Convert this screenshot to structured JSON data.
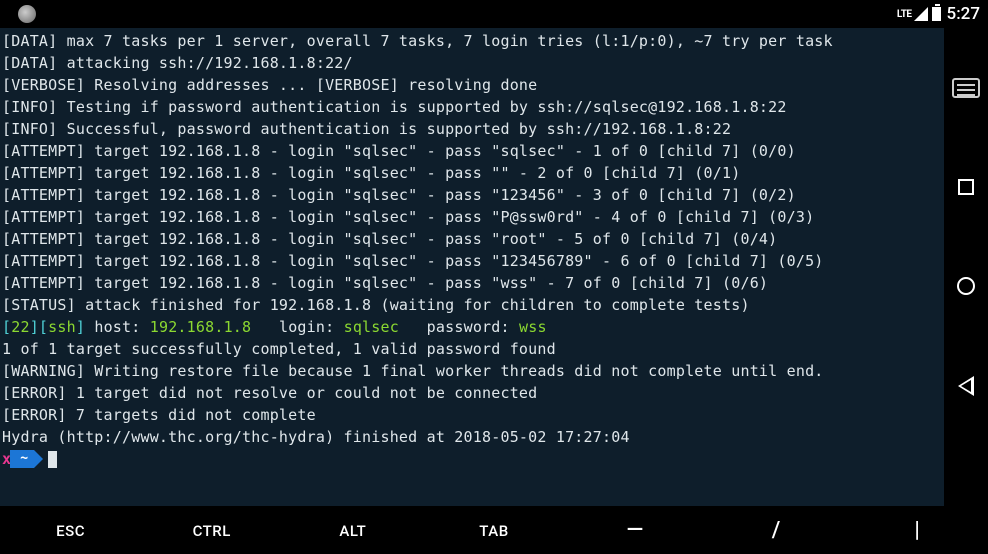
{
  "status": {
    "network": "LTE",
    "clock": "5:27"
  },
  "terminal": {
    "lines": [
      {
        "parts": [
          {
            "c": "lbl",
            "t": "[DATA] max 7 tasks per 1 server, overall 7 tasks, 7 login tries (l:1/p:0), ~7 try per task"
          }
        ]
      },
      {
        "parts": [
          {
            "c": "lbl",
            "t": "[DATA] attacking ssh://192.168.1.8:22/"
          }
        ]
      },
      {
        "parts": [
          {
            "c": "lbl",
            "t": "[VERBOSE] Resolving addresses ... [VERBOSE] resolving done"
          }
        ]
      },
      {
        "parts": [
          {
            "c": "lbl",
            "t": "[INFO] Testing if password authentication is supported by ssh://sqlsec@192.168.1.8:22"
          }
        ]
      },
      {
        "parts": [
          {
            "c": "lbl",
            "t": "[INFO] Successful, password authentication is supported by ssh://192.168.1.8:22"
          }
        ]
      },
      {
        "parts": [
          {
            "c": "lbl",
            "t": "[ATTEMPT] target 192.168.1.8 - login \"sqlsec\" - pass \"sqlsec\" - 1 of 0 [child 7] (0/0)"
          }
        ]
      },
      {
        "parts": [
          {
            "c": "lbl",
            "t": "[ATTEMPT] target 192.168.1.8 - login \"sqlsec\" - pass \"\" - 2 of 0 [child 7] (0/1)"
          }
        ]
      },
      {
        "parts": [
          {
            "c": "lbl",
            "t": "[ATTEMPT] target 192.168.1.8 - login \"sqlsec\" - pass \"123456\" - 3 of 0 [child 7] (0/2)"
          }
        ]
      },
      {
        "parts": [
          {
            "c": "lbl",
            "t": "[ATTEMPT] target 192.168.1.8 - login \"sqlsec\" - pass \"P@ssw0rd\" - 4 of 0 [child 7] (0/3)"
          }
        ]
      },
      {
        "parts": [
          {
            "c": "lbl",
            "t": "[ATTEMPT] target 192.168.1.8 - login \"sqlsec\" - pass \"root\" - 5 of 0 [child 7] (0/4)"
          }
        ]
      },
      {
        "parts": [
          {
            "c": "lbl",
            "t": "[ATTEMPT] target 192.168.1.8 - login \"sqlsec\" - pass \"123456789\" - 6 of 0 [child 7] (0/5)"
          }
        ]
      },
      {
        "parts": [
          {
            "c": "lbl",
            "t": "[ATTEMPT] target 192.168.1.8 - login \"sqlsec\" - pass \"wss\" - 7 of 0 [child 7] (0/6)"
          }
        ]
      },
      {
        "parts": [
          {
            "c": "lbl",
            "t": "[STATUS] attack finished for 192.168.1.8 (waiting for children to complete tests)"
          }
        ]
      },
      {
        "parts": [
          {
            "c": "cyn",
            "t": "["
          },
          {
            "c": "grn",
            "t": "22"
          },
          {
            "c": "cyn",
            "t": "]["
          },
          {
            "c": "grn",
            "t": "ssh"
          },
          {
            "c": "cyn",
            "t": "] "
          },
          {
            "c": "lbl",
            "t": "host: "
          },
          {
            "c": "grn",
            "t": "192.168.1.8"
          },
          {
            "c": "lbl",
            "t": "   login: "
          },
          {
            "c": "grn",
            "t": "sqlsec"
          },
          {
            "c": "lbl",
            "t": "   password: "
          },
          {
            "c": "grn",
            "t": "wss"
          }
        ]
      },
      {
        "parts": [
          {
            "c": "lbl",
            "t": "1 of 1 target successfully completed, 1 valid password found"
          }
        ]
      },
      {
        "parts": [
          {
            "c": "lbl",
            "t": "[WARNING] Writing restore file because 1 final worker threads did not complete until end."
          }
        ]
      },
      {
        "parts": [
          {
            "c": "lbl",
            "t": "[ERROR] 1 target did not resolve or could not be connected"
          }
        ]
      },
      {
        "parts": [
          {
            "c": "lbl",
            "t": "[ERROR] 7 targets did not complete"
          }
        ]
      },
      {
        "parts": [
          {
            "c": "lbl",
            "t": "Hydra (http://www.thc.org/thc-hydra) finished at 2018-05-02 17:27:04"
          }
        ]
      }
    ],
    "prompt_x": "x",
    "prompt_tilde": "~"
  },
  "bottom_keys": [
    {
      "label": "ESC",
      "sym": false
    },
    {
      "label": "CTRL",
      "sym": false
    },
    {
      "label": "ALT",
      "sym": false
    },
    {
      "label": "TAB",
      "sym": false
    },
    {
      "label": "—",
      "sym": true
    },
    {
      "label": "/",
      "sym": true
    },
    {
      "label": "|",
      "sym": true
    }
  ]
}
